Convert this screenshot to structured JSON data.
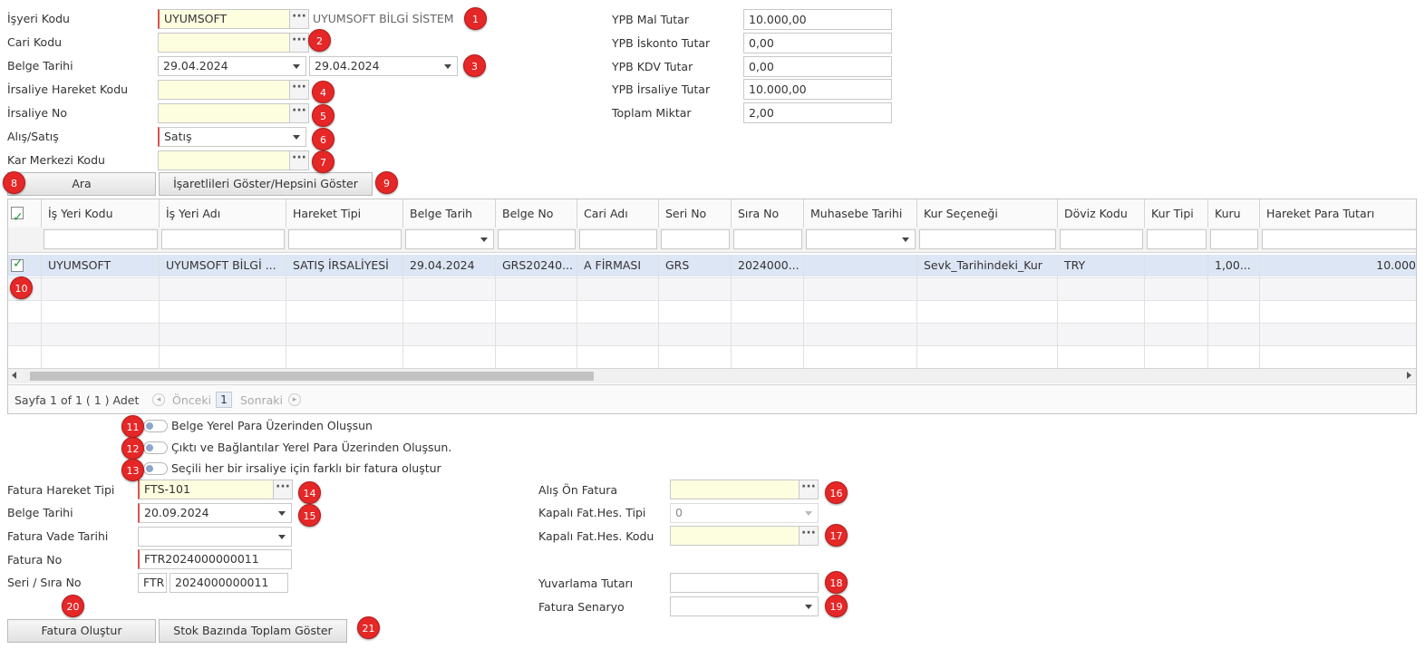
{
  "top_form": {
    "isyeri_kodu_label": "İşyeri Kodu",
    "isyeri_kodu_value": "UYUMSOFT",
    "isyeri_name": "UYUMSOFT BİLGİ SİSTEM",
    "cari_kodu_label": "Cari Kodu",
    "cari_kodu_value": "",
    "belge_tarihi_label": "Belge Tarihi",
    "belge_tarihi_from": "29.04.2024",
    "belge_tarihi_to": "29.04.2024",
    "irsaliye_hareket_kodu_label": "İrsaliye Hareket Kodu",
    "irsaliye_hareket_kodu_value": "",
    "irsaliye_no_label": "İrsaliye No",
    "irsaliye_no_value": "",
    "alis_satis_label": "Alış/Satış",
    "alis_satis_value": "Satış",
    "kar_merkezi_label": "Kar Merkezi Kodu",
    "kar_merkezi_value": ""
  },
  "lookup_glyph": "···",
  "summary": {
    "ypb_mal_tutar_label": "YPB Mal Tutar",
    "ypb_mal_tutar_value": "10.000,00",
    "ypb_iskonto_label": "YPB İskonto Tutar",
    "ypb_iskonto_value": "0,00",
    "ypb_kdv_label": "YPB KDV Tutar",
    "ypb_kdv_value": "0,00",
    "ypb_irsaliye_label": "YPB İrsaliye Tutar",
    "ypb_irsaliye_value": "10.000,00",
    "toplam_miktar_label": "Toplam Miktar",
    "toplam_miktar_value": "2,00"
  },
  "buttons": {
    "ara": "Ara",
    "toggle_marked": "İşaretlileri Göster/Hepsini Göster",
    "fatura_olustur": "Fatura Oluştur",
    "stok_bazinda": "Stok Bazında Toplam Göster"
  },
  "grid": {
    "columns": [
      "İş Yeri Kodu",
      "İş Yeri Adı",
      "Hareket Tipi",
      "Belge Tarih",
      "Belge No",
      "Cari Adı",
      "Seri No",
      "Sıra No",
      "Muhasebe Tarihi",
      "Kur Seçeneği",
      "Döviz Kodu",
      "Kur Tipi",
      "Kuru",
      "Hareket Para Tutarı"
    ],
    "row": [
      "UYUMSOFT",
      "UYUMSOFT BİLGİ ...",
      "SATIŞ İRSALİYESİ",
      "29.04.2024",
      "GRS20240...",
      "A FİRMASI",
      "GRS",
      "2024000...",
      "",
      "Sevk_Tarihindeki_Kur",
      "TRY",
      "",
      "1,00...",
      "10.000"
    ],
    "check_glyph": "✓",
    "pager": {
      "info": "Sayfa 1 of 1 ( 1 ) Adet",
      "prev": "Önceki",
      "page": "1",
      "next": "Sonraki"
    }
  },
  "toggles": {
    "belge_yerel": "Belge Yerel Para Üzerinden Oluşsun",
    "cikti_yerel": "Çıktı ve Bağlantılar Yerel Para Üzerinden Oluşsun.",
    "farkli_fatura": "Seçili her bir irsaliye için farklı bir fatura oluştur"
  },
  "invoice": {
    "fatura_hareket_tipi_label": "Fatura Hareket Tipi",
    "fatura_hareket_tipi_value": "FTS-101",
    "belge_tarihi_label": "Belge Tarihi",
    "belge_tarihi_value": "20.09.2024",
    "fatura_vade_label": "Fatura Vade Tarihi",
    "fatura_vade_value": "",
    "fatura_no_label": "Fatura No",
    "fatura_no_value": "FTR2024000000011",
    "seri_sira_label": "Seri / Sıra No",
    "seri_value": "FTR",
    "sira_value": "2024000000011",
    "alis_on_fatura_label": "Alış Ön Fatura",
    "alis_on_fatura_value": "",
    "kapali_tipi_label": "Kapalı Fat.Hes. Tipi",
    "kapali_tipi_value": "0",
    "kapali_kodu_label": "Kapalı Fat.Hes. Kodu",
    "kapali_kodu_value": "",
    "yuvarlama_label": "Yuvarlama Tutarı",
    "yuvarlama_value": "",
    "senaryo_label": "Fatura Senaryo",
    "senaryo_value": ""
  },
  "badges": [
    "1",
    "2",
    "3",
    "4",
    "5",
    "6",
    "7",
    "8",
    "9",
    "10",
    "11",
    "12",
    "13",
    "14",
    "15",
    "16",
    "17",
    "18",
    "19",
    "20",
    "21"
  ],
  "colors": {
    "badge": "#e52727",
    "required_border": "#d9534f",
    "lookup_bg": "#fdfde0",
    "selected_row": "#dde6f5"
  }
}
